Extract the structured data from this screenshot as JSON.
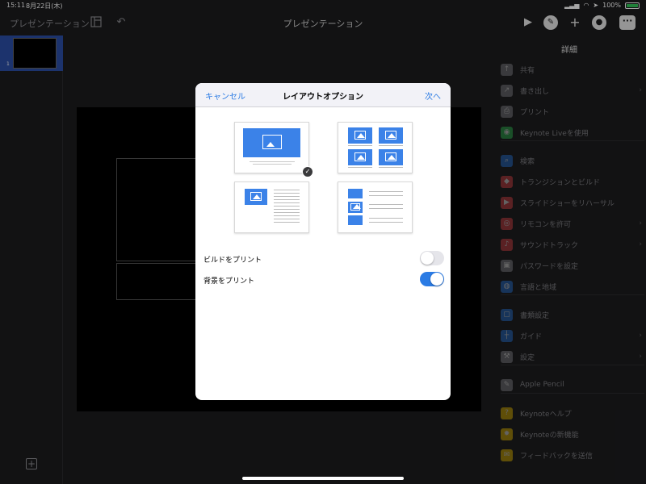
{
  "status": {
    "time": "15:11",
    "date": "8月22日(木)",
    "battery": "100%"
  },
  "toolbar": {
    "doc_name": "プレゼンテーション",
    "title": "プレゼンテーション"
  },
  "navigator": {
    "slide_number": "1"
  },
  "panel": {
    "title": "詳細",
    "items": [
      {
        "label": "共有",
        "icon": "share-icon",
        "color": "#8e8e93"
      },
      {
        "label": "書き出し",
        "icon": "export-icon",
        "color": "#8e8e93"
      },
      {
        "label": "プリント",
        "icon": "printer-icon",
        "color": "#8e8e93"
      },
      {
        "label": "Keynote Liveを使用",
        "icon": "keynote-live-icon",
        "color": "#34c759"
      },
      {
        "label": "検索",
        "icon": "search-icon",
        "color": "#2b7be4"
      },
      {
        "label": "トランジションとビルド",
        "icon": "transition-icon",
        "color": "#e5484d"
      },
      {
        "label": "スライドショーをリハーサル",
        "icon": "rehearse-icon",
        "color": "#e5484d"
      },
      {
        "label": "リモコンを許可",
        "icon": "remote-icon",
        "color": "#e5484d"
      },
      {
        "label": "サウンドトラック",
        "icon": "music-icon",
        "color": "#e5484d"
      },
      {
        "label": "パスワードを設定",
        "icon": "lock-icon",
        "color": "#8e8e93"
      },
      {
        "label": "言語と地域",
        "icon": "globe-icon",
        "color": "#2b7be4"
      },
      {
        "label": "書類設定",
        "icon": "document-setup-icon",
        "color": "#2b7be4"
      },
      {
        "label": "ガイド",
        "icon": "guides-icon",
        "color": "#2b7be4"
      },
      {
        "label": "設定",
        "icon": "wrench-icon",
        "color": "#8e8e93"
      },
      {
        "label": "Apple Pencil",
        "icon": "pencil-icon",
        "color": "#8e8e93"
      },
      {
        "label": "Keynoteヘルプ",
        "icon": "help-icon",
        "color": "#f5c400"
      },
      {
        "label": "Keynoteの新機能",
        "icon": "new-features-icon",
        "color": "#f5c400"
      },
      {
        "label": "フィードバックを送信",
        "icon": "feedback-icon",
        "color": "#f5c400"
      }
    ]
  },
  "modal": {
    "cancel": "キャンセル",
    "title": "レイアウトオプション",
    "next": "次へ",
    "selected_layout": "1",
    "options": [
      {
        "label": "ビルドをプリント",
        "on": false
      },
      {
        "label": "背景をプリント",
        "on": true
      }
    ]
  }
}
